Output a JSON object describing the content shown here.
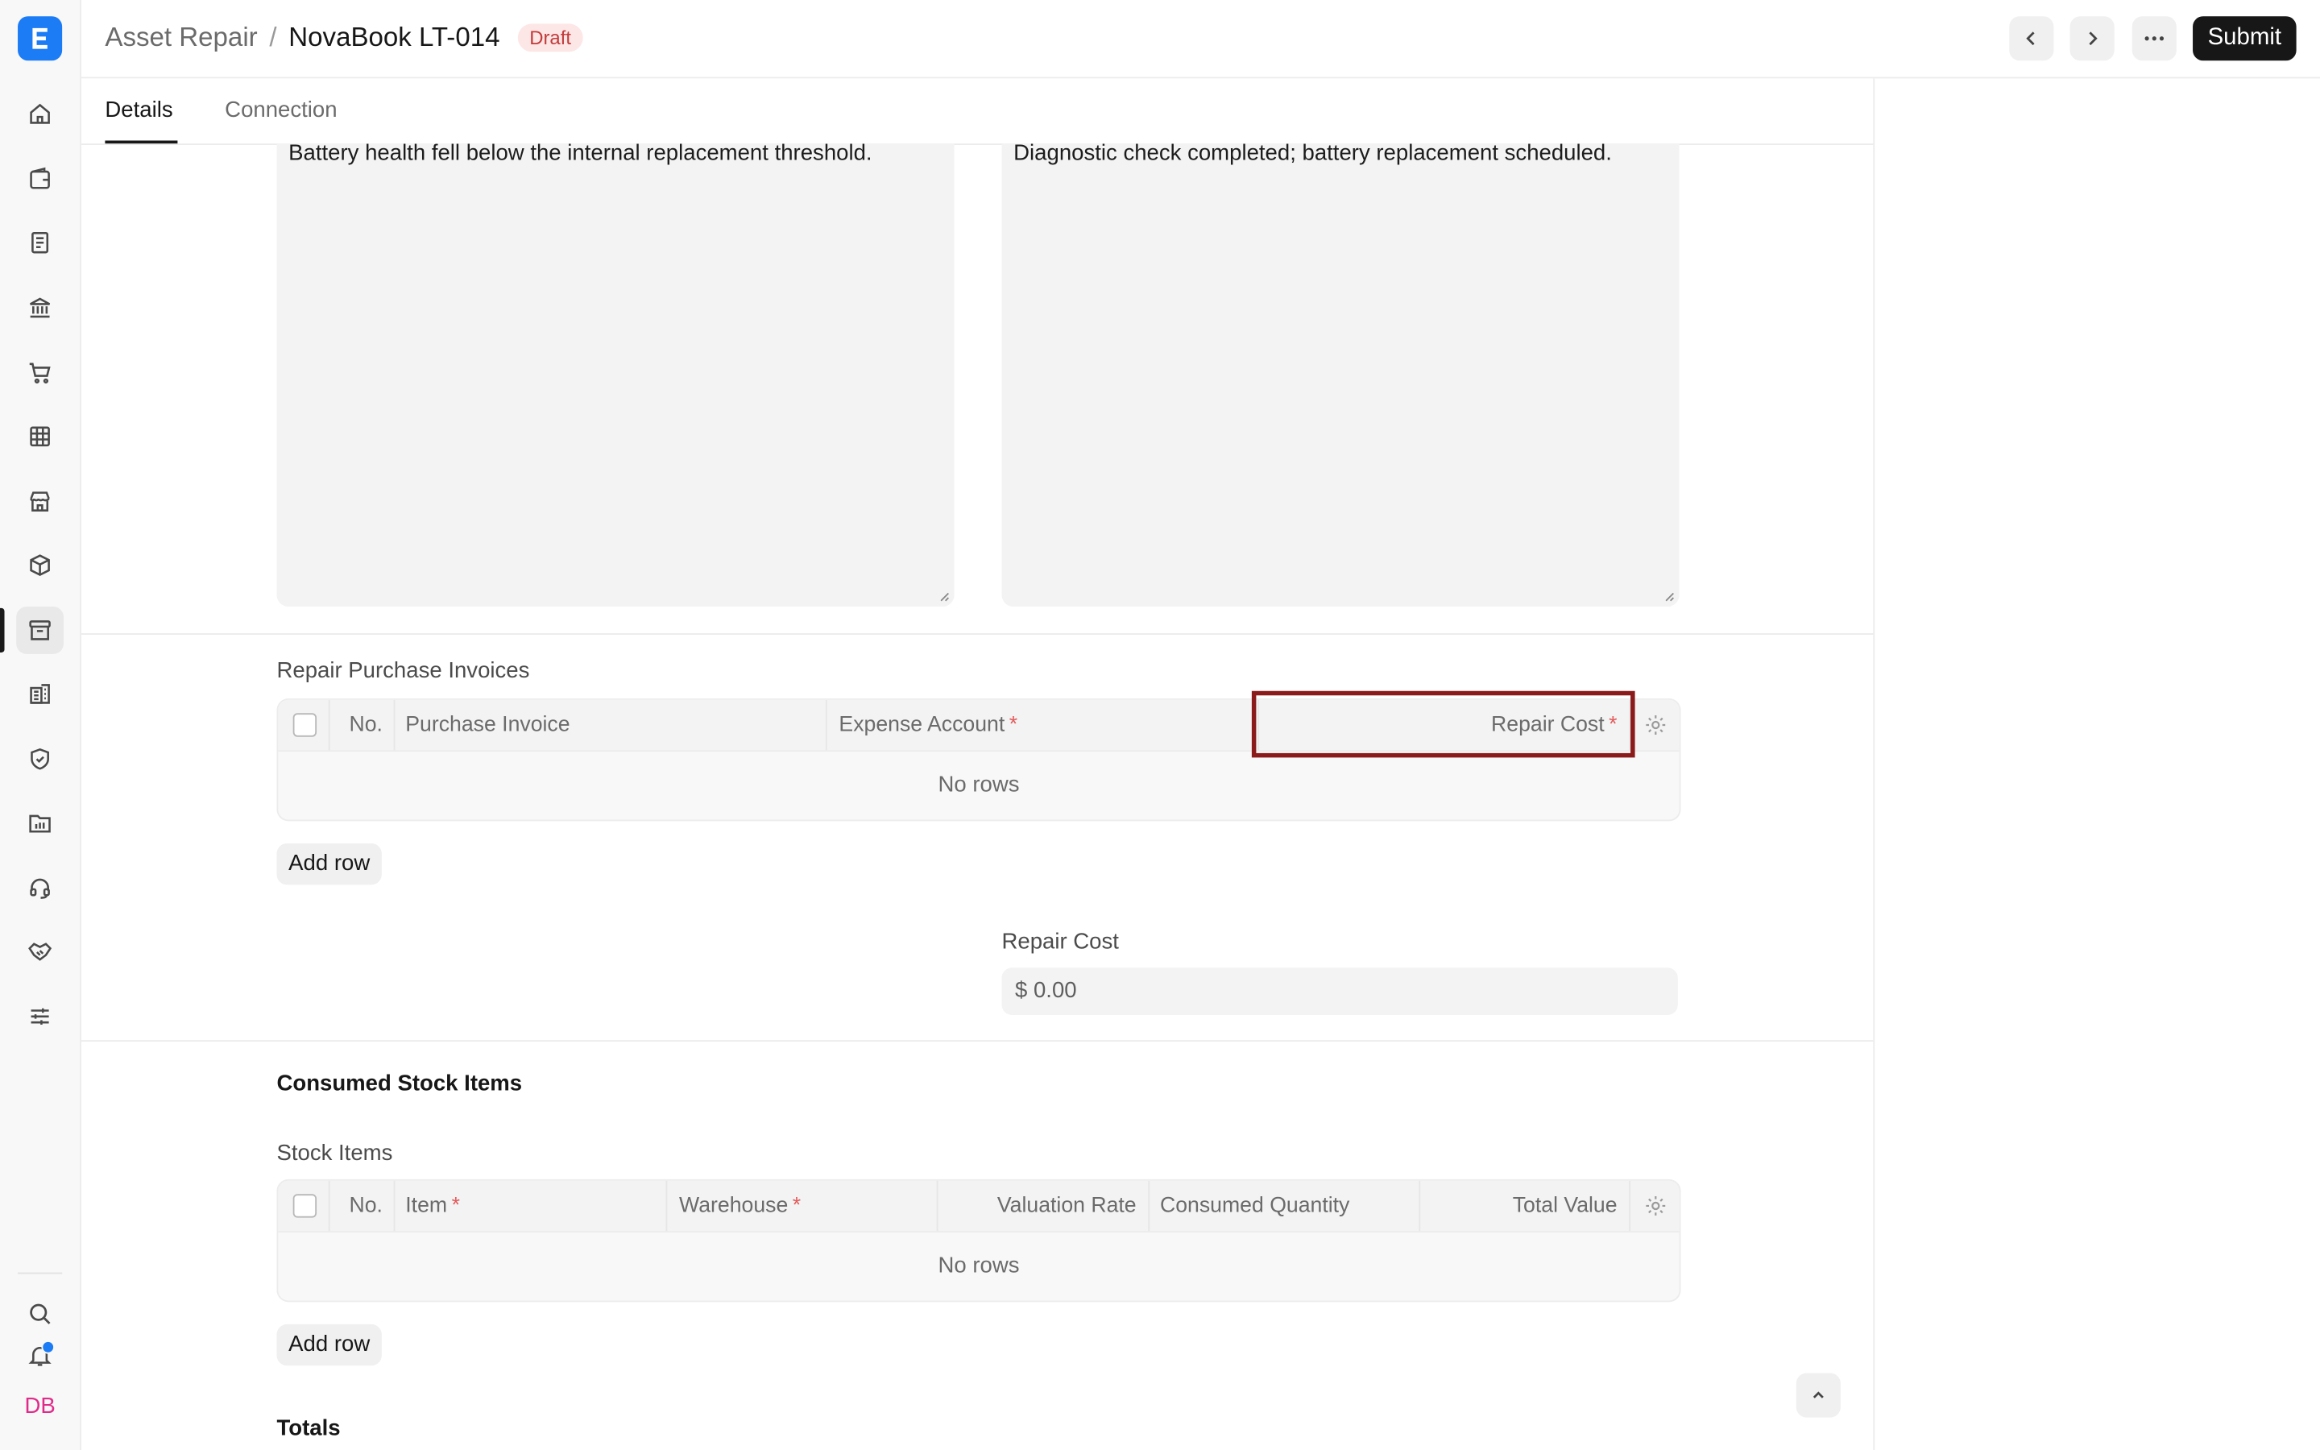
{
  "header": {
    "breadcrumb_parent": "Asset Repair",
    "breadcrumb_separator": "/",
    "title": "NovaBook LT-014",
    "status_badge": "Draft",
    "submit_label": "Submit"
  },
  "tabs": [
    {
      "label": "Details",
      "active": true
    },
    {
      "label": "Connection",
      "active": false
    }
  ],
  "sidebar": {
    "items": [
      {
        "icon": "home-icon"
      },
      {
        "icon": "wallet-icon"
      },
      {
        "icon": "document-icon"
      },
      {
        "icon": "bank-icon"
      },
      {
        "icon": "cart-icon"
      },
      {
        "icon": "table-icon"
      },
      {
        "icon": "store-icon"
      },
      {
        "icon": "package-icon"
      },
      {
        "icon": "archive-icon",
        "active": true
      },
      {
        "icon": "building-icon"
      },
      {
        "icon": "shield-icon"
      },
      {
        "icon": "folder-chart-icon"
      },
      {
        "icon": "headset-icon"
      },
      {
        "icon": "handshake-icon"
      },
      {
        "icon": "sliders-icon"
      }
    ],
    "bottom": {
      "search": "search-icon",
      "notifications": "bell-icon",
      "avatar": "DB"
    }
  },
  "form": {
    "description_text": "Battery health fell below the internal replacement threshold.",
    "actions_text": "Diagnostic check completed; battery replacement scheduled.",
    "repair_invoices": {
      "label": "Repair Purchase Invoices",
      "columns": {
        "no": "No.",
        "purchase_invoice": "Purchase Invoice",
        "expense_account": "Expense Account",
        "repair_cost": "Repair Cost"
      },
      "required_marker": "*",
      "empty_text": "No rows",
      "add_row": "Add row"
    },
    "repair_cost": {
      "label": "Repair Cost",
      "value": "$ 0.00"
    },
    "consumed_stock": {
      "section_title": "Consumed Stock Items",
      "label": "Stock Items",
      "columns": {
        "no": "No.",
        "item": "Item",
        "warehouse": "Warehouse",
        "valuation_rate": "Valuation Rate",
        "consumed_quantity": "Consumed Quantity",
        "total_value": "Total Value"
      },
      "empty_text": "No rows",
      "add_row": "Add row"
    },
    "totals_title": "Totals"
  },
  "colors": {
    "brand": "#1c7cf5",
    "highlight": "#8b1a1a",
    "draft_badge_bg": "#fde6e6",
    "draft_badge_text": "#c23b3b",
    "avatar": "#e02b8a"
  }
}
